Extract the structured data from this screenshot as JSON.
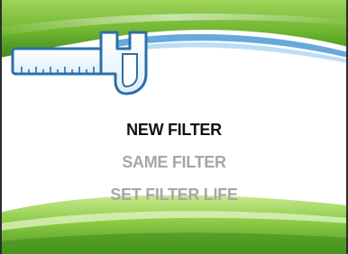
{
  "colors": {
    "green_light": "#b6e07a",
    "green_mid": "#7dc23a",
    "green_dark": "#3f8a1c",
    "blue_accent": "#4a9bd6",
    "selected_text": "#111111",
    "dim_text": "#a7a7a7"
  },
  "header": {
    "icon": "caliper-icon"
  },
  "menu": {
    "items": [
      {
        "label": "NEW FILTER",
        "state": "selected"
      },
      {
        "label": "SAME FILTER",
        "state": "unselected"
      },
      {
        "label": "SET FILTER LIFE",
        "state": "unselected"
      }
    ]
  }
}
